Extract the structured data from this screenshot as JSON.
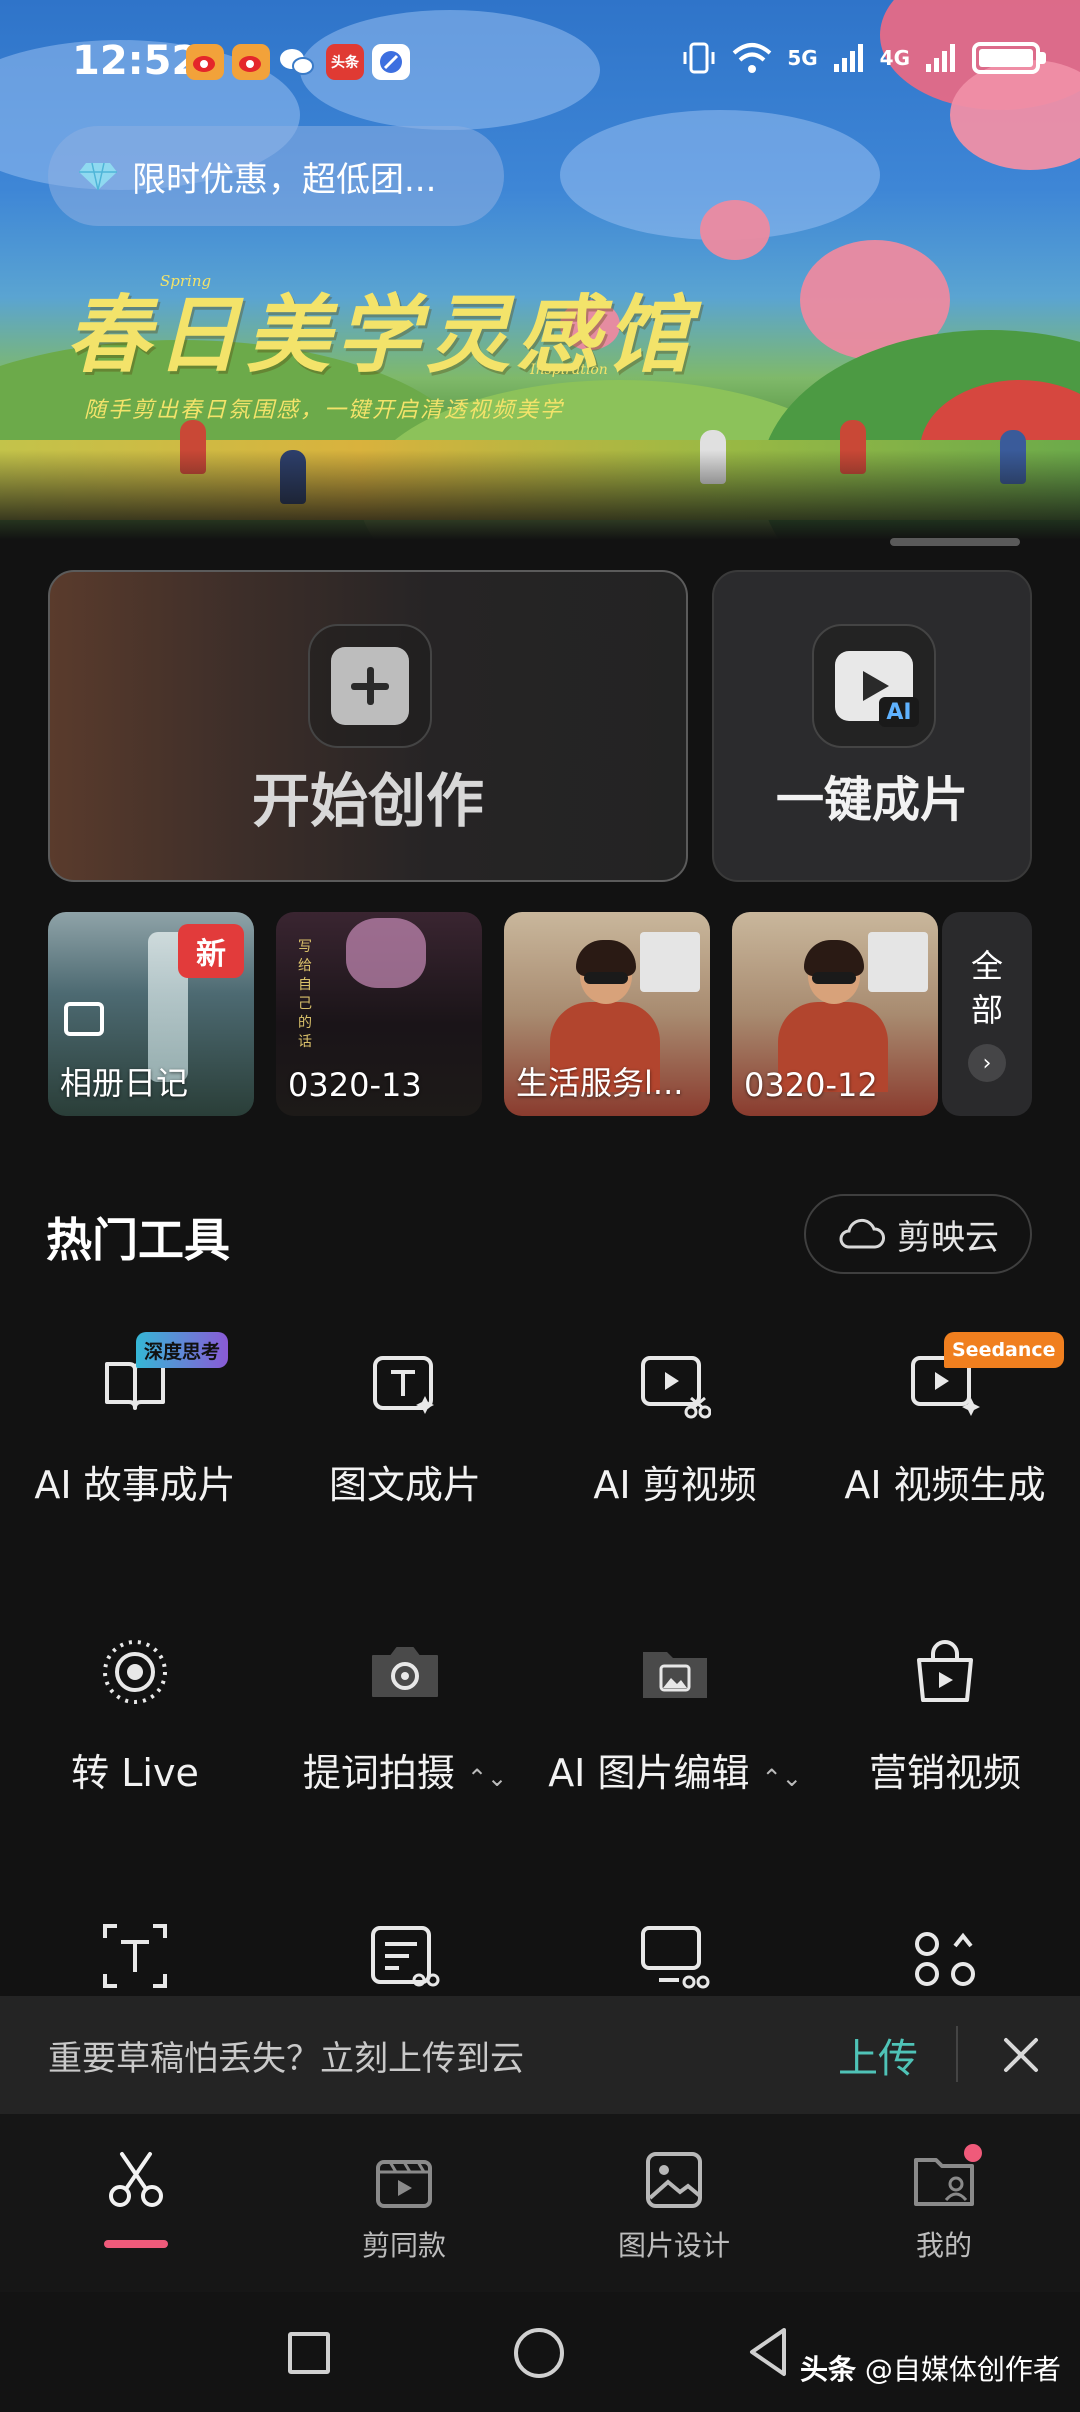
{
  "status_bar": {
    "time": "12:52",
    "notification_icons": [
      "weibo-icon",
      "weibo-icon",
      "wechat-icon",
      "toutiao-icon",
      "browser-icon"
    ],
    "toutiao_label": "头条",
    "network_5g": "5G",
    "network_4g": "4G"
  },
  "banner": {
    "promo_text": "限时优惠，超低团...",
    "title": "春日美学灵感馆",
    "tag_spring": "Spring",
    "tag_inspiration": "Inspiration",
    "subtitle": "随手剪出春日氛围感，一键开启清透视频美学"
  },
  "primary_actions": {
    "start_label": "开始创作",
    "ai_label": "一键成片",
    "ai_badge": "AI"
  },
  "drafts": {
    "items": [
      {
        "title": "相册日记",
        "badge": "新"
      },
      {
        "title": "0320-13"
      },
      {
        "title": "生活服务l..."
      },
      {
        "title": "0320-12"
      }
    ],
    "all_label_1": "全",
    "all_label_2": "部",
    "draft2_overlay_text": "写给自己的话"
  },
  "hot_tools": {
    "title": "热门工具",
    "cloud_label": "剪映云",
    "items": [
      {
        "label": "AI 故事成片",
        "badge": "深度思考",
        "icon": "book-icon"
      },
      {
        "label": "图文成片",
        "icon": "text-frame-icon"
      },
      {
        "label": "AI 剪视频",
        "icon": "video-scissors-icon"
      },
      {
        "label": "AI 视频生成",
        "badge": "Seedance",
        "icon": "video-sparkle-icon"
      },
      {
        "label": "转 Live",
        "icon": "live-icon"
      },
      {
        "label": "提词拍摄",
        "icon": "camera-icon"
      },
      {
        "label": "AI 图片编辑",
        "icon": "image-folder-icon"
      },
      {
        "label": "营销视频",
        "icon": "shopping-bag-icon"
      }
    ]
  },
  "upload_bar": {
    "message": "重要草稿怕丢失？立刻上传到云",
    "action": "上传"
  },
  "tab_bar": {
    "items": [
      {
        "label": "",
        "icon": "scissors-icon",
        "active": true
      },
      {
        "label": "剪同款",
        "icon": "clapper-icon"
      },
      {
        "label": "图片设计",
        "icon": "image-icon"
      },
      {
        "label": "我的",
        "icon": "profile-folder-icon"
      }
    ]
  },
  "watermark": {
    "brand": "头条",
    "text": "@自媒体创作者"
  },
  "colors": {
    "accent_teal": "#4fc3b7",
    "tab_active": "#ef5a7a",
    "new_badge": "#e23b3b",
    "seedance_badge": "#f07f1f"
  }
}
